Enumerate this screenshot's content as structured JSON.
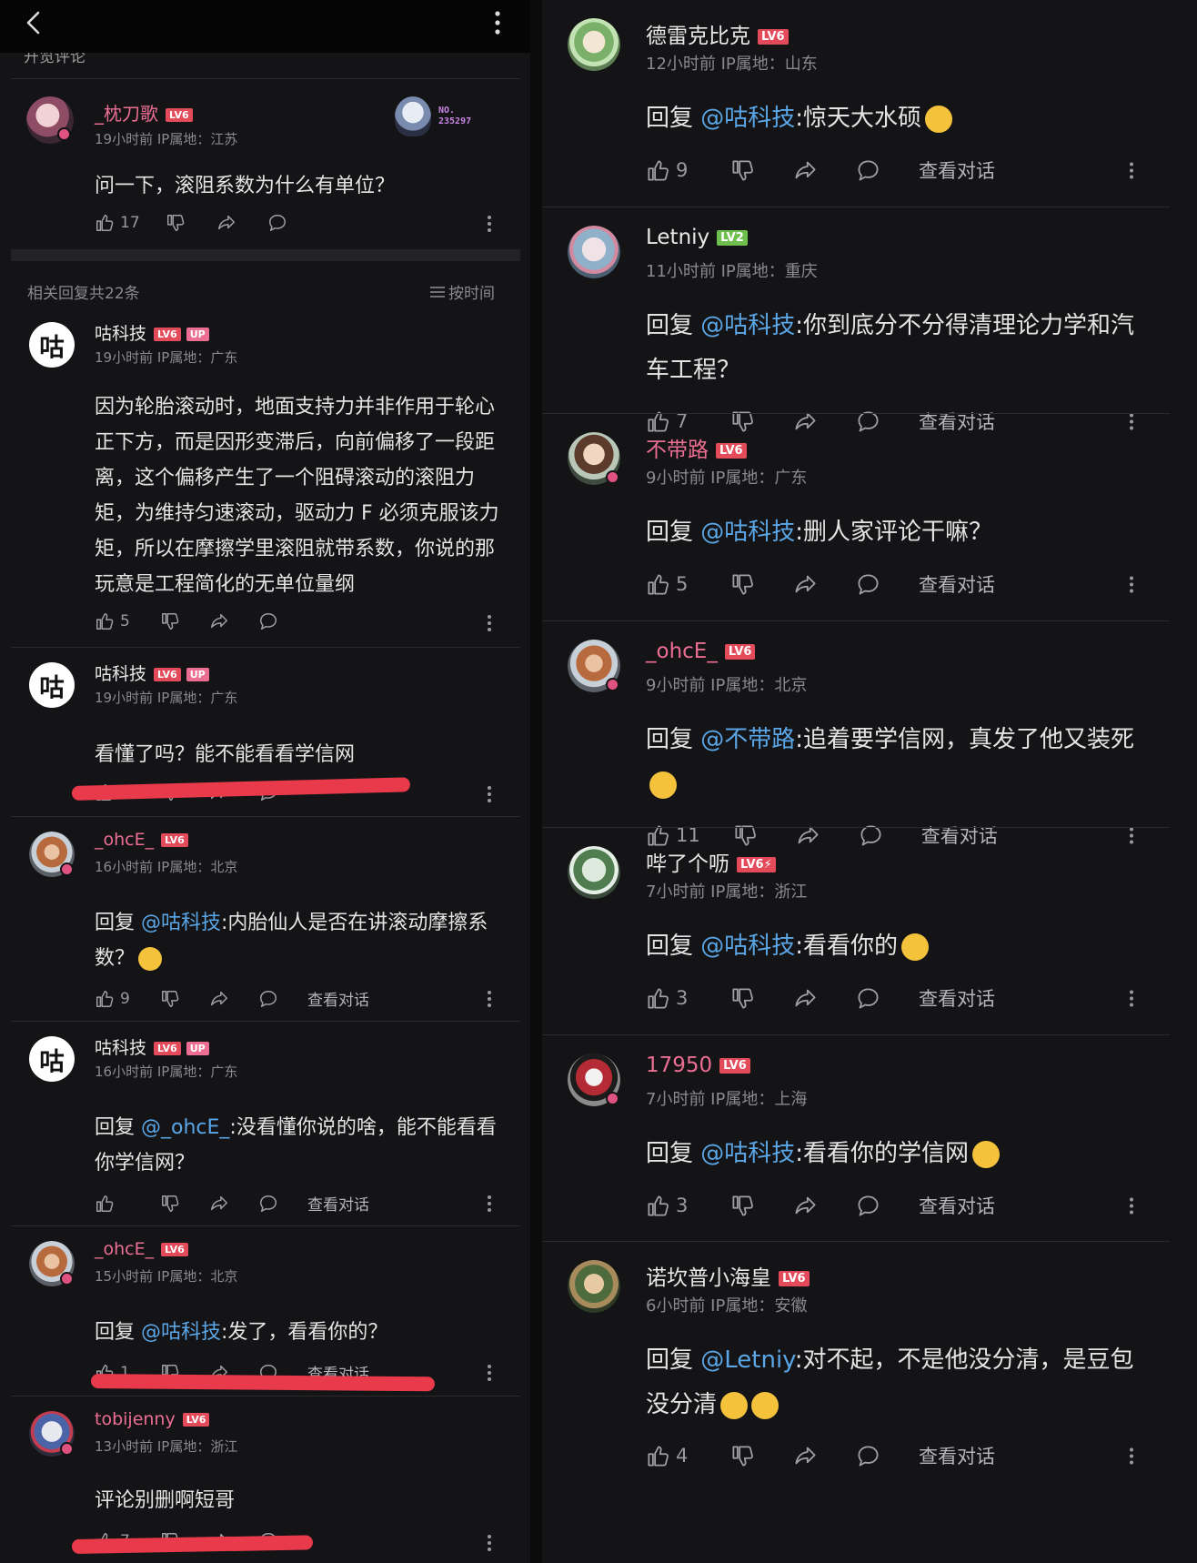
{
  "top": {
    "partial_text": "开览评论"
  },
  "colors": {
    "accent_pink": "#ec6e93",
    "mention_blue": "#5aa6e6",
    "level_red": "#e34a5a",
    "level_green": "#6fbf4f",
    "underline_red": "#e93a4b"
  },
  "original": {
    "name": "_枕刀歌",
    "level": "LV6",
    "meta": "19小时前 IP属地：江苏",
    "fan_badge": "NO.\n235297",
    "text": "问一下，滚阻系数为什么有单位？",
    "likes": "17"
  },
  "section": {
    "title": "相关回复共22条",
    "sort": "按时间"
  },
  "left_comments": [
    {
      "name": "咕科技",
      "level": "LV6",
      "up": "UP",
      "meta": "19小时前 IP属地：广东",
      "text": "因为轮胎滚动时，地面支持力并非作用于轮心正下方，而是因形变滞后，向前偏移了一段距离，这个偏移产生了一个阻碍滚动的滚阻力矩，为维持匀速滚动，驱动力 F 必须克服该力矩，所以在摩擦学里滚阻就带系数，你说的那玩意是工程简化的无单位量纲",
      "likes": "5"
    },
    {
      "name": "咕科技",
      "level": "LV6",
      "up": "UP",
      "meta": "19小时前 IP属地：广东",
      "text": "看懂了吗？能不能看看学信网",
      "likes": "1"
    },
    {
      "name": "_ohcE_",
      "level": "LV6",
      "meta": "16小时前 IP属地：北京",
      "reply_prefix": "回复 ",
      "mention": "@咕科技",
      "text": ":内胎仙人是否在讲滚动摩擦系数？",
      "likes": "9",
      "view": "查看对话"
    },
    {
      "name": "咕科技",
      "level": "LV6",
      "up": "UP",
      "meta": "16小时前 IP属地：广东",
      "reply_prefix": "回复 ",
      "mention": "@_ohcE_",
      "text": ":没看懂你说的啥，能不能看看你学信网？",
      "likes": "",
      "view": "查看对话"
    },
    {
      "name": "_ohcE_",
      "level": "LV6",
      "meta": "15小时前 IP属地：北京",
      "reply_prefix": "回复 ",
      "mention": "@咕科技",
      "text": ":发了，看看你的？",
      "likes": "1",
      "view": "查看对话"
    },
    {
      "name": "tobijenny",
      "level": "LV6",
      "meta": "13小时前 IP属地：浙江",
      "text": "评论别删啊短哥",
      "likes": "7"
    }
  ],
  "right_comments": [
    {
      "name": "德雷克比克",
      "level": "LV6",
      "meta": "12小时前 IP属地：山东",
      "reply_prefix": "回复 ",
      "mention": "@咕科技",
      "text": ":惊天大水硕",
      "likes": "9",
      "view": "查看对话"
    },
    {
      "name": "Letniy",
      "level": "LV2",
      "meta": "11小时前 IP属地：重庆",
      "reply_prefix": "回复 ",
      "mention": "@咕科技",
      "text": ":你到底分不分得清理论力学和汽车工程？",
      "likes": "7",
      "view": "查看对话"
    },
    {
      "name": "不带路",
      "level": "LV6",
      "meta": "9小时前 IP属地：广东",
      "reply_prefix": "回复 ",
      "mention": "@咕科技",
      "text": ":删人家评论干嘛？",
      "likes": "5",
      "view": "查看对话"
    },
    {
      "name": "_ohcE_",
      "level": "LV6",
      "meta": "9小时前 IP属地：北京",
      "reply_prefix": "回复 ",
      "mention": "@不带路",
      "text": ":追着要学信网，真发了他又装死",
      "likes": "11",
      "view": "查看对话"
    },
    {
      "name": "哔了个呖",
      "level": "LV6⚡",
      "meta": "7小时前 IP属地：浙江",
      "reply_prefix": "回复 ",
      "mention": "@咕科技",
      "text": ":看看你的",
      "likes": "3",
      "view": "查看对话"
    },
    {
      "name": "17950",
      "level": "LV6",
      "meta": "7小时前 IP属地：上海",
      "reply_prefix": "回复 ",
      "mention": "@咕科技",
      "text": ":看看你的学信网",
      "likes": "3",
      "view": "查看对话"
    },
    {
      "name": "诺坎普小海皇",
      "level": "LV6",
      "meta": "6小时前 IP属地：安徽",
      "reply_prefix": "回复 ",
      "mention": "@Letniy",
      "text": ":对不起，不是他没分清，是豆包没分清",
      "likes": "4",
      "view": "查看对话"
    }
  ],
  "icons": [
    "back-arrow-icon",
    "more-vertical-icon",
    "thumbs-up-icon",
    "thumbs-down-icon",
    "share-icon",
    "comment-bubble-icon",
    "sort-icon"
  ]
}
